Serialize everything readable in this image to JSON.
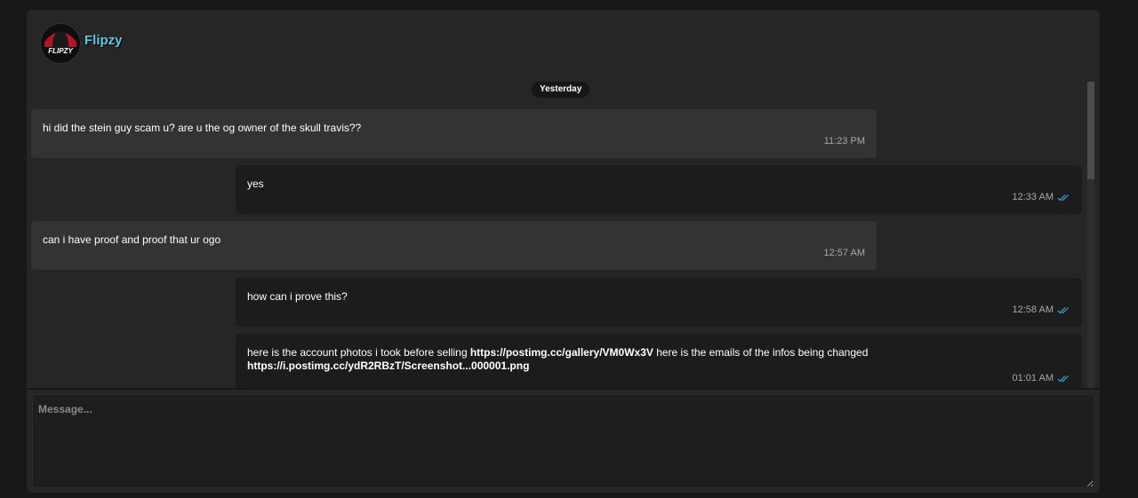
{
  "header": {
    "username": "Flipzy",
    "avatar_text": "FLIPZY"
  },
  "date_separator": "Yesterday",
  "messages": [
    {
      "direction": "incoming",
      "text": "hi did the stein guy scam u? are u the og owner of the skull travis??",
      "time": "11:23 PM"
    },
    {
      "direction": "outgoing",
      "text": "yes",
      "time": "12:33 AM",
      "status": "read"
    },
    {
      "direction": "incoming",
      "text": "can i have proof and proof that ur ogo",
      "time": "12:57 AM"
    },
    {
      "direction": "outgoing",
      "text": "how can i prove this?",
      "time": "12:58 AM",
      "status": "read"
    },
    {
      "direction": "outgoing",
      "text_part1": "here is the account photos i took before selling ",
      "link1": "https://postimg.cc/gallery/VM0Wx3V",
      "text_part2": " here is the emails of the infos being changed ",
      "link2": "https://i.postimg.cc/ydR2RBzT/Screenshot...000001.png",
      "time": "01:01 AM",
      "status": "read"
    }
  ],
  "composer": {
    "placeholder": "Message..."
  },
  "colors": {
    "background": "#181818",
    "card": "#262626",
    "incoming_bubble": "#333333",
    "outgoing_bubble": "#1c1c1c",
    "username": "#5fc8e0",
    "read_ticks": "#3aa7d6"
  },
  "icons": {
    "read_receipt": "double-check-icon",
    "avatar": "hooded-figure-logo"
  }
}
